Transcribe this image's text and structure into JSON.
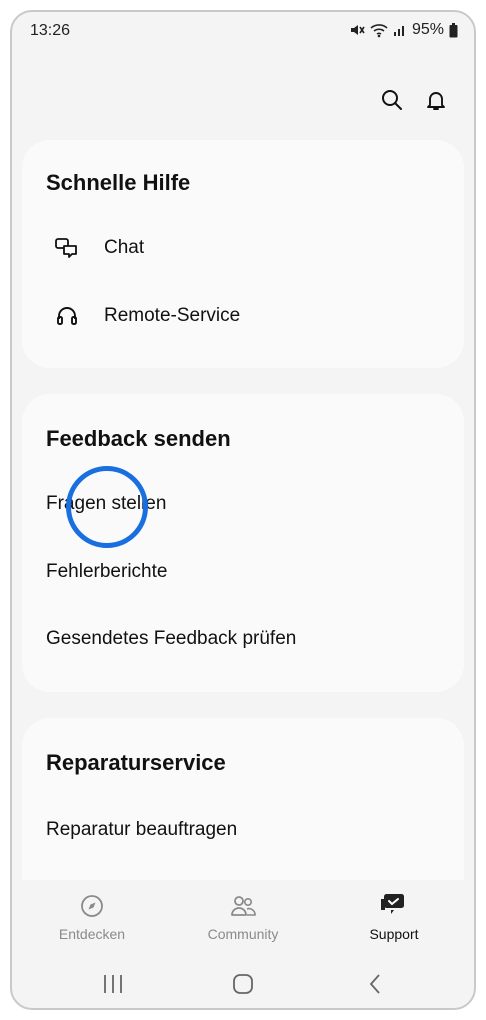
{
  "status_bar": {
    "time": "13:26",
    "battery": "95%"
  },
  "toolbar": {
    "search_icon": "search-icon",
    "notifications_icon": "bell-icon"
  },
  "quick_help": {
    "title": "Schnelle Hilfe",
    "items": [
      {
        "label": "Chat",
        "icon": "chat-icon"
      },
      {
        "label": "Remote-Service",
        "icon": "headset-icon"
      }
    ]
  },
  "feedback": {
    "title": "Feedback senden",
    "items": [
      {
        "label": "Fragen stellen"
      },
      {
        "label": "Fehlerberichte"
      },
      {
        "label": "Gesendetes Feedback prüfen"
      }
    ]
  },
  "repair": {
    "title": "Reparaturservice",
    "items": [
      {
        "label": "Reparatur beauftragen"
      }
    ]
  },
  "bottom_nav": {
    "items": [
      {
        "label": "Entdecken",
        "icon": "compass-icon",
        "active": false
      },
      {
        "label": "Community",
        "icon": "people-icon",
        "active": false
      },
      {
        "label": "Support",
        "icon": "support-chat-icon",
        "active": true
      }
    ]
  },
  "colors": {
    "accent": "#1a6fe0",
    "background": "#f4f4f4",
    "card": "#fafafa"
  }
}
